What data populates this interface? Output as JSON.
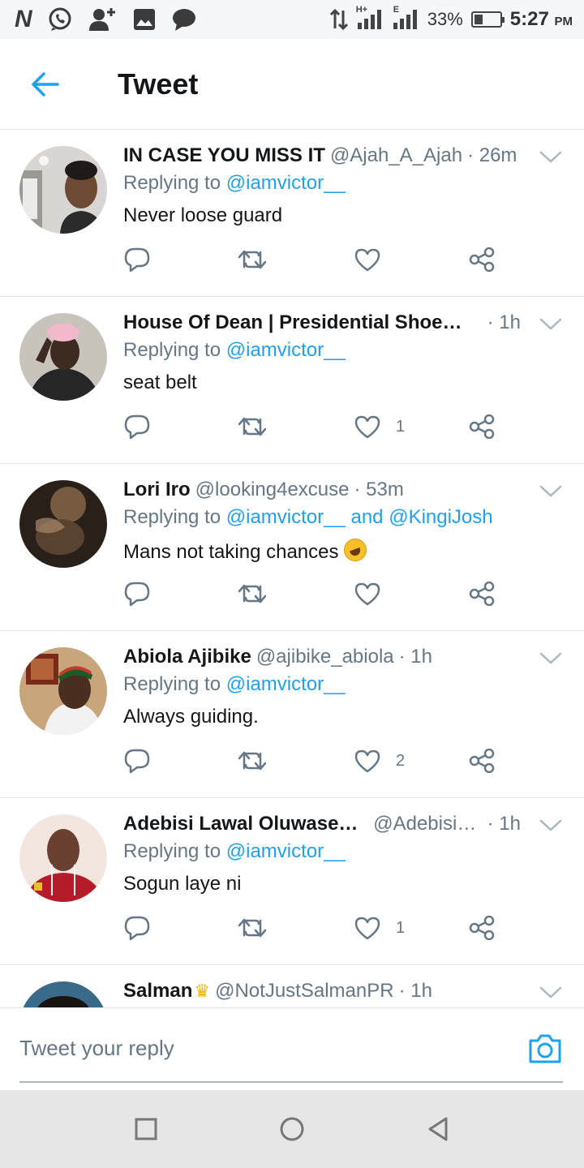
{
  "status_bar": {
    "left_icons": [
      "n-logo-icon",
      "whatsapp-icon",
      "add-user-icon",
      "gallery-icon",
      "message-icon"
    ],
    "n_logo": "N",
    "network_h": "H+",
    "network_e": "E",
    "battery": "33%",
    "battery_level": 0.33,
    "time": "5:27",
    "ampm": "PM"
  },
  "header": {
    "title": "Tweet"
  },
  "colors": {
    "accent": "#1da1f2",
    "secondary_text": "#657786",
    "divider": "#e1e8ed"
  },
  "tweets": [
    {
      "name": "IN CASE YOU MISS IT",
      "handle": "@Ajah_A_Ajah",
      "time": "· 26m",
      "replying_prefix": "Replying to",
      "mentions": "@iamvictor__",
      "text": "Never loose guard",
      "likes": ""
    },
    {
      "name": "House Of Dean | Presidential Shoema...",
      "handle": "",
      "time": "· 1h",
      "replying_prefix": "Replying to",
      "mentions": "@iamvictor__",
      "text": "seat belt",
      "likes": "1"
    },
    {
      "name": "Lori Iro",
      "handle": "@looking4excuse",
      "time": "· 53m",
      "replying_prefix": "Replying to",
      "mentions": "@iamvictor__ and @KingiJosh",
      "text": "Mans not taking chances",
      "likes": ""
    },
    {
      "name": "Abiola Ajibike",
      "handle": "@ajibike_abiola",
      "time": "· 1h",
      "replying_prefix": "Replying to",
      "mentions": "@iamvictor__",
      "text": "Always guiding.",
      "likes": "2"
    },
    {
      "name": "Adebisi Lawal Oluwasesan",
      "handle": "@AdebisiL...",
      "time": "· 1h",
      "replying_prefix": "Replying to",
      "mentions": "@iamvictor__",
      "text": "Sogun laye ni",
      "likes": "1"
    },
    {
      "name": "Salman",
      "handle": "@NotJustSalmanPR",
      "time": "· 1h"
    }
  ],
  "reply_bar": {
    "placeholder": "Tweet your reply"
  },
  "nav": {
    "buttons": [
      "recents-square-icon",
      "home-circle-icon",
      "back-triangle-icon"
    ]
  }
}
